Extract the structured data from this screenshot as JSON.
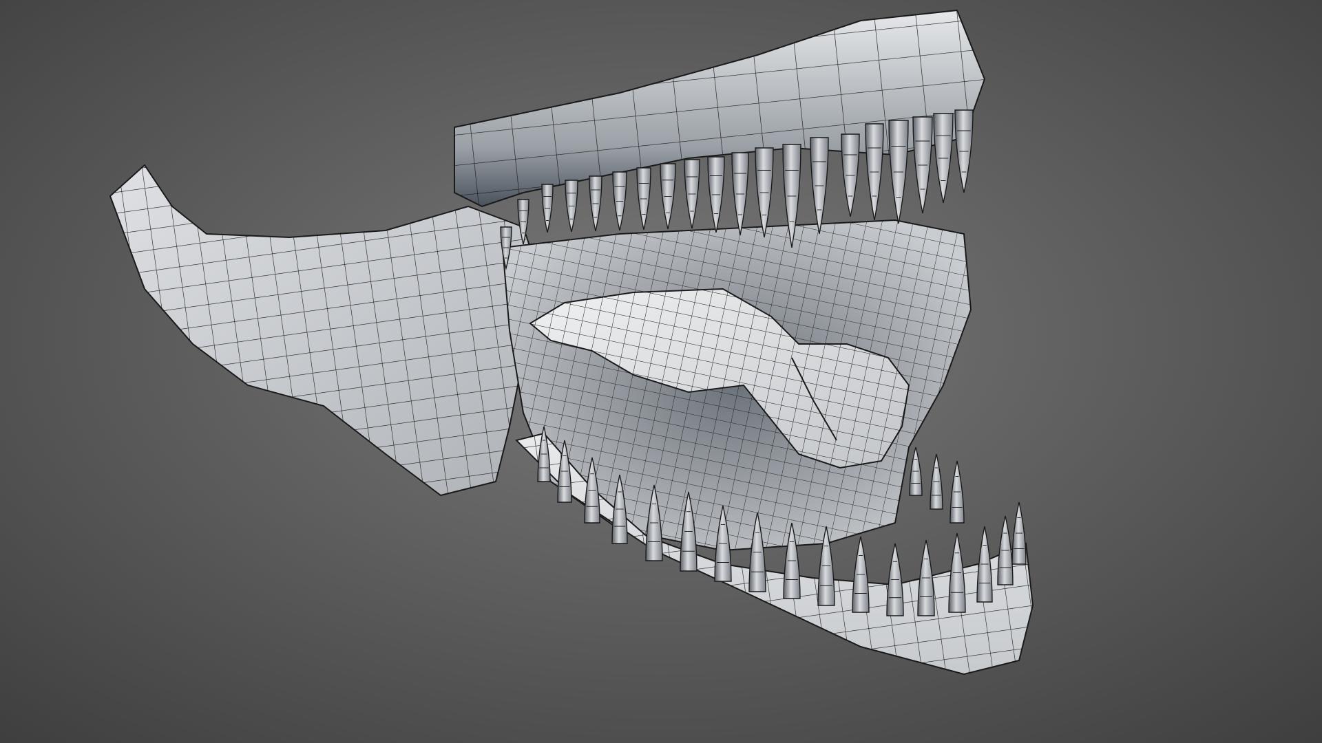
{
  "scene": {
    "subject": "creature-jaw-wireframe-render",
    "background_colors": {
      "center": "#7a7a7a",
      "edge": "#3e3e3e"
    },
    "surface_colors": {
      "light": "#e6e8ea",
      "mid": "#b9bcc0",
      "dark": "#4a525c",
      "wire": "#1a1a1a"
    },
    "icons": [
      "upper-jaw",
      "lower-jaw",
      "tongue",
      "teeth",
      "wireframe-grid"
    ]
  }
}
